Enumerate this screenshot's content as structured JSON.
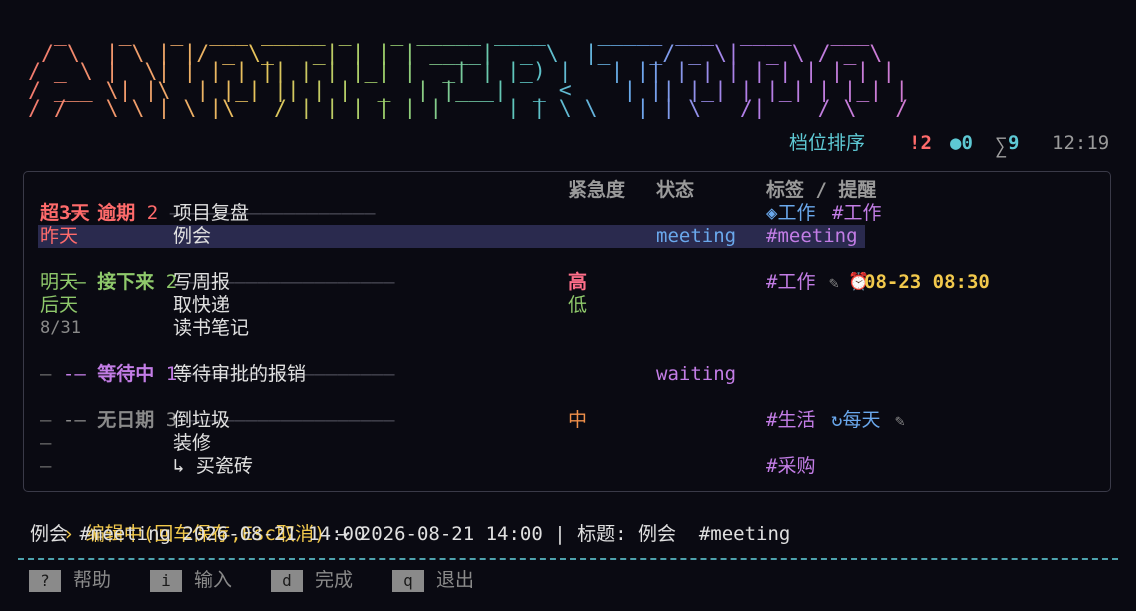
{
  "banner": {
    "title": "ANOTHER TODO",
    "art": "  _    _   _  ___ _____ _   _ _____ ____    _____ ___  ____   ___  \n / \\  | \\ | |/ _ \\_   _| | | | ____|  _ \\  |_   _/ _ \\|  _ \\ / _ \\ \n/ _ \\ |  \\| | | | || | | |_| |  _| | |_) |   | || | | | | | | | | |\n/ ___ \\| |\\  | |_| || | |  _  | |___|  _ <    | || |_| | |_| | |_| |\n/_/   \\_\\_| \\_|\\___/ |_| |_| |_|_____|_| \\_\\   |_| \\___/|____/ \\___/ "
  },
  "status": {
    "mode": "档位排序",
    "overdue": "!2",
    "active": "●0",
    "sigma": "∑",
    "total": "9",
    "time": "12:19"
  },
  "table": {
    "headers": {
      "urgency": "紧急度",
      "state": "状态",
      "tags": "标签 / 提醒"
    }
  },
  "sections": [
    {
      "marker": "-—",
      "title": "逾期",
      "count": "2",
      "line": "——————————————————"
    },
    {
      "marker": "-—",
      "title": "接下来",
      "count": "2",
      "line": "——————————————————"
    },
    {
      "marker": "-—",
      "title": "等待中",
      "count": "1",
      "line": "——————————————————"
    },
    {
      "marker": "-—",
      "title": "无日期",
      "count": "3",
      "line": "——————————————————"
    }
  ],
  "rows": [
    {
      "date": "超3天",
      "title": "项目复盘",
      "urgency": "",
      "state": "",
      "tag1": "◈工作",
      "tag2": "#工作"
    },
    {
      "date": "昨天",
      "title": "例会",
      "urgency": "",
      "state": "meeting",
      "tag1": "#meeting"
    },
    {
      "date": "明天",
      "title": "写周报",
      "urgency": "高",
      "state": "",
      "tag1": "#工作",
      "pencil": "✎",
      "alarm": "⏰",
      "reminder": "08-23 08:30"
    },
    {
      "date": "后天",
      "title": "取快递",
      "urgency": "低",
      "state": ""
    },
    {
      "date": "8/31",
      "title": "读书笔记",
      "urgency": "",
      "state": ""
    },
    {
      "date": "–",
      "title": "等待审批的报销",
      "urgency": "",
      "state": "waiting"
    },
    {
      "date": "–",
      "title": "倒垃圾",
      "urgency": "中",
      "state": "",
      "tag1": "#生活",
      "repeat": "↻每天",
      "pencil": "✎"
    },
    {
      "date": "–",
      "title": "装修",
      "urgency": "",
      "state": ""
    },
    {
      "date": "–",
      "title": "↳ 买瓷砖",
      "urgency": "",
      "state": "",
      "tag1": "#采购"
    }
  ],
  "editor": {
    "caret": "›",
    "mode": "编辑中(回车保存,Esc取消)",
    "rest": " → 2026-08-21 14:00 | 标题: 例会  #meeting",
    "preview": "例会 #meeting 2026-08-21 14:00"
  },
  "footer": {
    "keys": [
      {
        "key": "?",
        "label": "帮助"
      },
      {
        "key": "i",
        "label": "输入"
      },
      {
        "key": "d",
        "label": "完成"
      },
      {
        "key": "q",
        "label": "退出"
      }
    ]
  }
}
